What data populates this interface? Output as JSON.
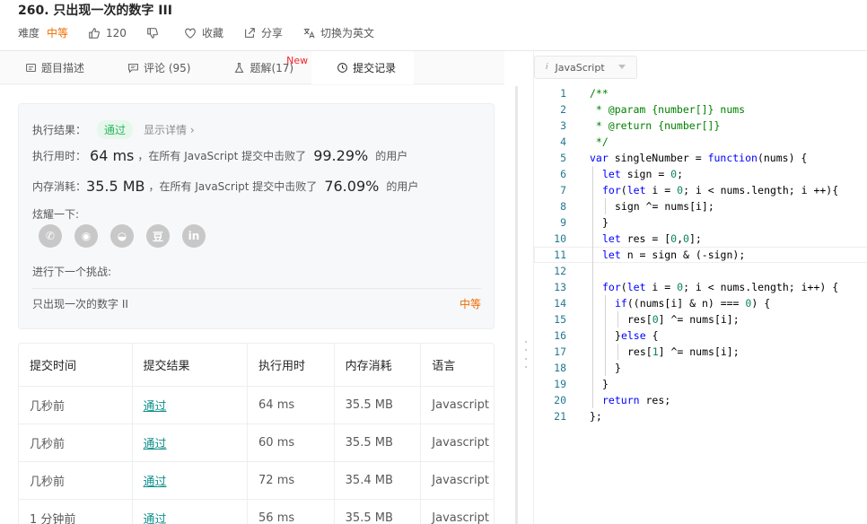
{
  "header": {
    "title": "260. 只出现一次的数字 III",
    "difficulty_label": "难度",
    "difficulty": "中等",
    "likes": "120",
    "favorite": "收藏",
    "share": "分享",
    "switch_lang": "切换为英文"
  },
  "tabs": [
    {
      "label": "题目描述"
    },
    {
      "label": "评论 (95)"
    },
    {
      "label": "题解(17)",
      "badge": "New"
    },
    {
      "label": "提交记录"
    }
  ],
  "result": {
    "exec_result_label": "执行结果：",
    "status": "通过",
    "detail_link": "显示详情 ›",
    "time_label": "执行用时：",
    "time_value": "64 ms",
    "time_text": "，在所有 JavaScript 提交中击败了",
    "time_pct": "99.29%",
    "users": "的用户",
    "mem_label": "内存消耗：",
    "mem_value": "35.5 MB",
    "mem_text": "，在所有 JavaScript 提交中击败了",
    "mem_pct": "76.09%",
    "brag": "炫耀一下:",
    "share_icons": [
      "wechat-icon",
      "weibo-icon",
      "qq-icon",
      "douban-icon",
      "linkedin-icon"
    ],
    "share_glyphs": [
      "✆",
      "◉",
      "◒",
      "豆",
      "in"
    ],
    "next_label": "进行下一个挑战:",
    "next_title": "只出现一次的数字 II",
    "next_difficulty": "中等"
  },
  "table": {
    "headers": [
      "提交时间",
      "提交结果",
      "执行用时",
      "内存消耗",
      "语言"
    ],
    "rows": [
      [
        "几秒前",
        "通过",
        "64 ms",
        "35.5 MB",
        "Javascript"
      ],
      [
        "几秒前",
        "通过",
        "60 ms",
        "35.5 MB",
        "Javascript"
      ],
      [
        "几秒前",
        "通过",
        "72 ms",
        "35.4 MB",
        "Javascript"
      ],
      [
        "1 分钟前",
        "通过",
        "56 ms",
        "35.5 MB",
        "Javascript"
      ]
    ]
  },
  "editor": {
    "language_icon": "i",
    "language": "JavaScript",
    "current_line": 11,
    "lines": [
      {
        "n": "1",
        "indent": 0,
        "parts": [
          [
            "cm",
            "/**"
          ]
        ]
      },
      {
        "n": "2",
        "indent": 0,
        "parts": [
          [
            "cm",
            " * @param {number[]} nums"
          ]
        ]
      },
      {
        "n": "3",
        "indent": 0,
        "parts": [
          [
            "cm",
            " * @return {number[]}"
          ]
        ]
      },
      {
        "n": "4",
        "indent": 0,
        "parts": [
          [
            "cm",
            " */"
          ]
        ]
      },
      {
        "n": "5",
        "indent": 0,
        "parts": [
          [
            "kw",
            "var"
          ],
          [
            "",
            " singleNumber = "
          ],
          [
            "kw",
            "function"
          ],
          [
            "",
            "(nums) {"
          ]
        ]
      },
      {
        "n": "6",
        "indent": 1,
        "parts": [
          [
            "kw",
            "let"
          ],
          [
            "",
            " sign = "
          ],
          [
            "num",
            "0"
          ],
          [
            "",
            ";"
          ]
        ]
      },
      {
        "n": "7",
        "indent": 1,
        "parts": [
          [
            "kw",
            "for"
          ],
          [
            "",
            "("
          ],
          [
            "kw",
            "let"
          ],
          [
            "",
            " i = "
          ],
          [
            "num",
            "0"
          ],
          [
            "",
            "; i < nums.length; i ++){"
          ]
        ]
      },
      {
        "n": "8",
        "indent": 2,
        "parts": [
          [
            "",
            "sign ^= nums[i];"
          ]
        ]
      },
      {
        "n": "9",
        "indent": 1,
        "parts": [
          [
            "",
            "}"
          ]
        ]
      },
      {
        "n": "10",
        "indent": 1,
        "parts": [
          [
            "kw",
            "let"
          ],
          [
            "",
            " res = ["
          ],
          [
            "num",
            "0"
          ],
          [
            "",
            ","
          ],
          [
            "num",
            "0"
          ],
          [
            "",
            "];"
          ]
        ]
      },
      {
        "n": "11",
        "indent": 1,
        "parts": [
          [
            "kw",
            "let"
          ],
          [
            "",
            " n = sign & (-sign);"
          ]
        ]
      },
      {
        "n": "12",
        "indent": 1,
        "parts": [
          [
            "",
            ""
          ]
        ]
      },
      {
        "n": "13",
        "indent": 1,
        "parts": [
          [
            "kw",
            "for"
          ],
          [
            "",
            "("
          ],
          [
            "kw",
            "let"
          ],
          [
            "",
            " i = "
          ],
          [
            "num",
            "0"
          ],
          [
            "",
            "; i < nums.length; i++) {"
          ]
        ]
      },
      {
        "n": "14",
        "indent": 2,
        "parts": [
          [
            "kw",
            "if"
          ],
          [
            "",
            "((nums[i] & n) === "
          ],
          [
            "num",
            "0"
          ],
          [
            "",
            ") {"
          ]
        ]
      },
      {
        "n": "15",
        "indent": 3,
        "parts": [
          [
            "",
            "res["
          ],
          [
            "num",
            "0"
          ],
          [
            "",
            "] ^= nums[i];"
          ]
        ]
      },
      {
        "n": "16",
        "indent": 2,
        "parts": [
          [
            "",
            "}"
          ],
          [
            "kw",
            "else"
          ],
          [
            "",
            " {"
          ]
        ]
      },
      {
        "n": "17",
        "indent": 3,
        "parts": [
          [
            "",
            "res["
          ],
          [
            "num",
            "1"
          ],
          [
            "",
            "] ^= nums[i];"
          ]
        ]
      },
      {
        "n": "18",
        "indent": 2,
        "parts": [
          [
            "",
            "}"
          ]
        ]
      },
      {
        "n": "19",
        "indent": 1,
        "parts": [
          [
            "",
            "}"
          ]
        ]
      },
      {
        "n": "20",
        "indent": 1,
        "parts": [
          [
            "kw",
            "return"
          ],
          [
            "",
            " res;"
          ]
        ]
      },
      {
        "n": "21",
        "indent": 0,
        "parts": [
          [
            "",
            "};"
          ]
        ]
      }
    ]
  },
  "colors": {
    "difficulty_medium": "#ef6c00",
    "pass_green": "#2db55d",
    "link_teal": "#0e8f8a",
    "keyword_blue": "#0000ff",
    "comment_green": "#008000",
    "number_green": "#098658",
    "line_number": "#237893"
  }
}
